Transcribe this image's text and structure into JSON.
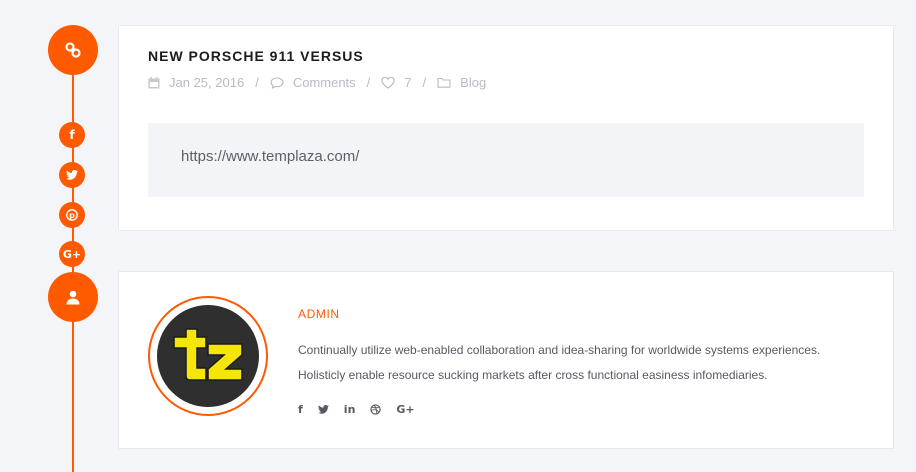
{
  "sidebar": {
    "share_icons": [
      "facebook-icon",
      "twitter-icon",
      "pinterest-icon",
      "google-plus-icon"
    ]
  },
  "post": {
    "title": "NEW PORSCHE 911 VERSUS",
    "date": "Jan 25, 2016",
    "separator": "/",
    "comments_label": "Comments",
    "likes": "7",
    "category": "Blog",
    "link_url": "https://www.templaza.com/"
  },
  "author": {
    "name": "ADMIN",
    "bio_line1": "Continually utilize web-enabled collaboration and idea-sharing for worldwide systems experiences.",
    "bio_line2": "Holisticly enable resource sucking markets after cross functional easiness infomediaries.",
    "social_icons": [
      "facebook-icon",
      "twitter-icon",
      "linkedin-icon",
      "dribbble-icon",
      "google-plus-icon"
    ],
    "avatar_logo_text": "tz"
  },
  "colors": {
    "accent": "#ff5a00",
    "background": "#f4f5f8",
    "card": "#ffffff",
    "meta_text": "#b7bbc4",
    "logo_yellow": "#f5e50a",
    "logo_dark": "#2f2f2f"
  }
}
